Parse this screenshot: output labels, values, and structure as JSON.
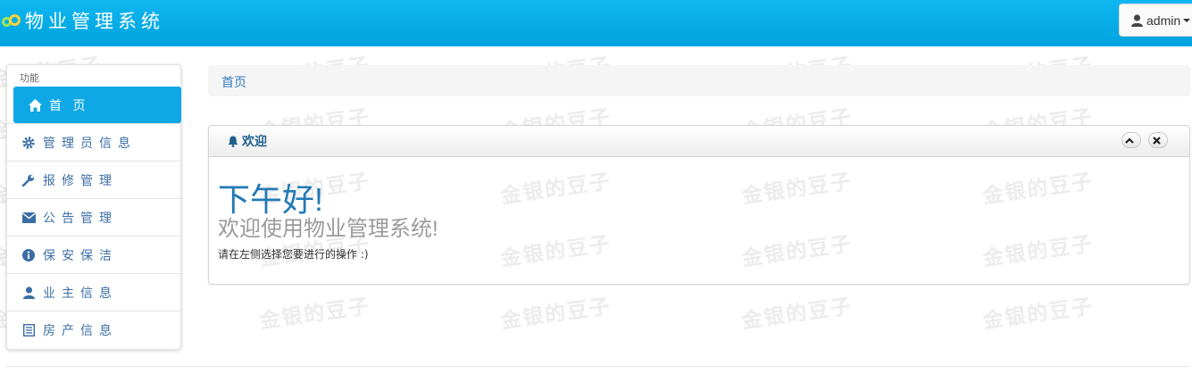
{
  "header": {
    "app_title": "物业管理系统",
    "user_name": "admin"
  },
  "sidebar": {
    "section_label": "功能",
    "items": [
      {
        "label": "首 页",
        "icon": "home-icon",
        "active": true
      },
      {
        "label": "管理员信息",
        "icon": "gear-icon",
        "active": false
      },
      {
        "label": "报修管理",
        "icon": "wrench-icon",
        "active": false
      },
      {
        "label": "公告管理",
        "icon": "envelope-icon",
        "active": false
      },
      {
        "label": "保安保洁",
        "icon": "info-circle-icon",
        "active": false
      },
      {
        "label": "业主信息",
        "icon": "user-icon",
        "active": false
      },
      {
        "label": "房产信息",
        "icon": "list-icon",
        "active": false
      }
    ]
  },
  "breadcrumb": {
    "current": "首页"
  },
  "panel": {
    "title": "欢迎",
    "greeting": "下午好!",
    "welcome": "欢迎使用物业管理系统!",
    "hint": "请在左侧选择您要进行的操作 :)"
  },
  "watermark": {
    "text": "金银的豆子"
  },
  "colors": {
    "header": "#00a3de",
    "active_nav": "#0fa8e6",
    "link": "#337ab7",
    "greeting": "#227ab5"
  }
}
